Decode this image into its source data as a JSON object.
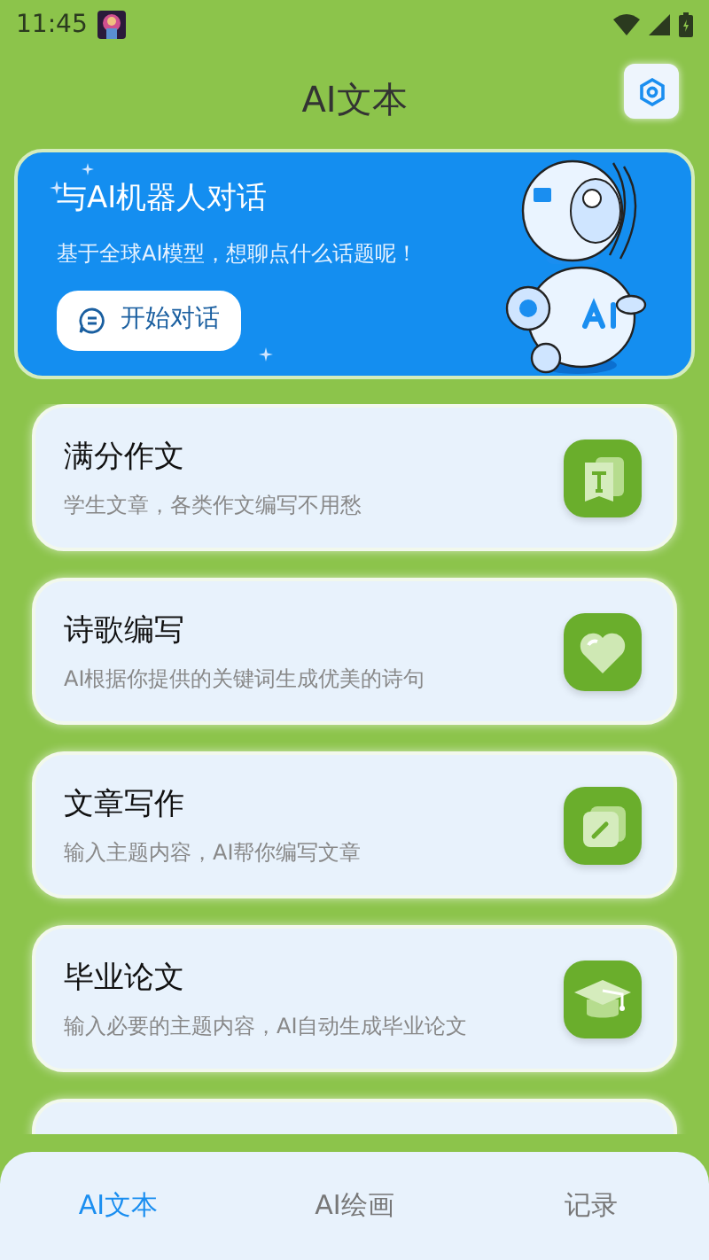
{
  "status_bar": {
    "time": "11:45"
  },
  "header": {
    "title": "AI文本"
  },
  "banner": {
    "title": "与AI机器人对话",
    "subtitle": "基于全球AI模型，想聊点什么话题呢！",
    "button": "开始对话"
  },
  "cards": [
    {
      "kind": "essay",
      "title": "满分作文",
      "description": "学生文章，各类作文编写不用愁"
    },
    {
      "kind": "poem",
      "title": "诗歌编写",
      "description": "AI根据你提供的关键词生成优美的诗句"
    },
    {
      "kind": "article",
      "title": "文章写作",
      "description": "输入主题内容，AI帮你编写文章"
    },
    {
      "kind": "thesis",
      "title": "毕业论文",
      "description": "输入必要的主题内容，AI自动生成毕业论文"
    },
    {
      "kind": "partial"
    }
  ],
  "tabs": [
    {
      "label": "AI文本",
      "selected": true
    },
    {
      "label": "AI绘画",
      "selected": false
    },
    {
      "label": "记录",
      "selected": false
    }
  ]
}
